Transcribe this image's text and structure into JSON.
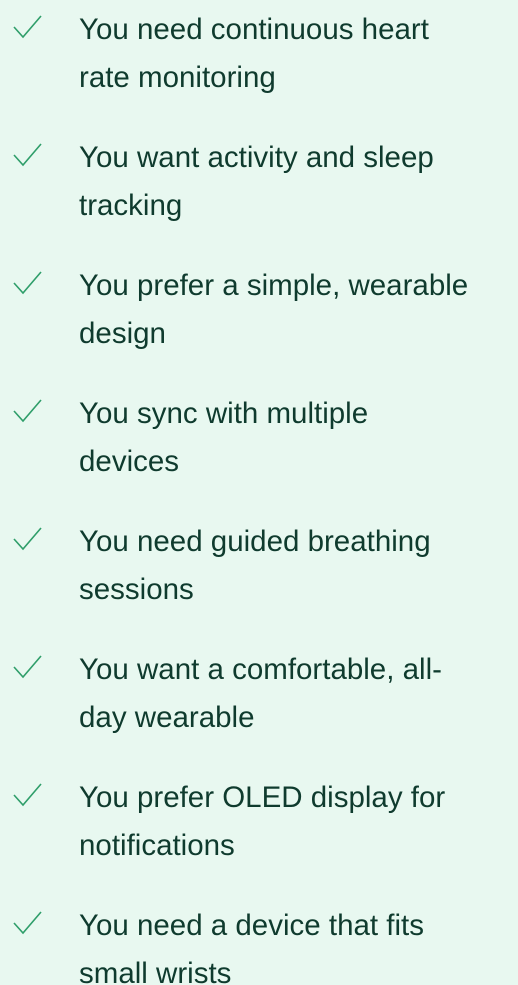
{
  "checklist": {
    "items": [
      {
        "icon": "check-icon",
        "line1": "You need continuous heart",
        "line2": "rate monitoring"
      },
      {
        "icon": "check-icon",
        "line1": "You want activity and sleep",
        "line2": "tracking"
      },
      {
        "icon": "check-icon",
        "line1": "You prefer a simple, wearable",
        "line2": "design"
      },
      {
        "icon": "check-icon",
        "line1": "You sync with multiple",
        "line2": "devices"
      },
      {
        "icon": "check-icon",
        "line1": "You need guided breathing",
        "line2": "sessions"
      },
      {
        "icon": "check-icon",
        "line1": "You want a comfortable, all-",
        "line2": "day wearable"
      },
      {
        "icon": "check-icon",
        "line1": "You prefer OLED display for",
        "line2": "notifications"
      },
      {
        "icon": "check-icon",
        "line1": "You need a device that fits",
        "line2": "small wrists"
      }
    ]
  },
  "colors": {
    "background": "#e8f8f0",
    "text": "#0f3b2e",
    "check": "#2f9e6a"
  }
}
